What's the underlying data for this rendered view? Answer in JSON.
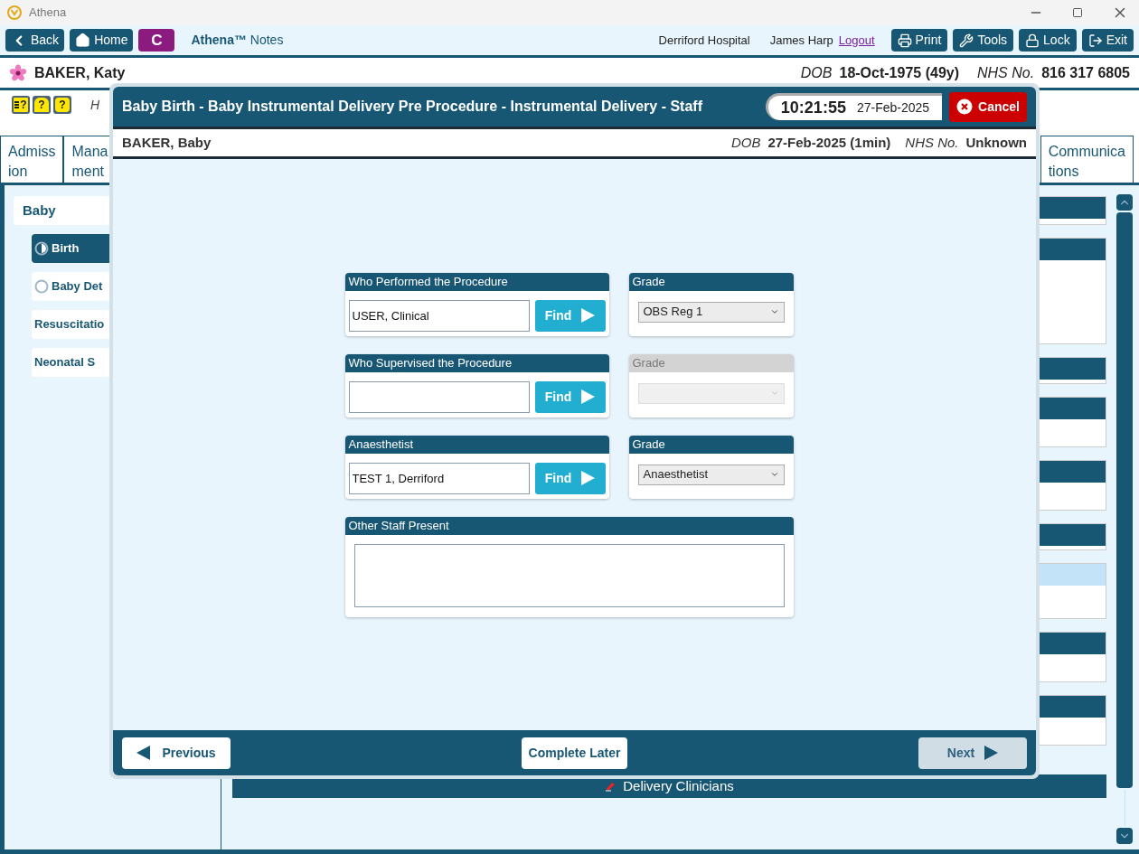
{
  "window": {
    "title": "Athena"
  },
  "toolbar": {
    "buttons": [
      {
        "kind": "back",
        "label": "Back"
      },
      {
        "kind": "home",
        "label": "Home"
      },
      {
        "kind": "letter",
        "label": "C"
      }
    ],
    "app_name": "Athena™",
    "app_suffix": "Notes",
    "hospital": "Derriford Hospital",
    "user": "James Harp",
    "logout": "Logout",
    "actions": [
      {
        "kind": "print",
        "label": "Print"
      },
      {
        "kind": "tools",
        "label": "Tools"
      },
      {
        "kind": "lock",
        "label": "Lock"
      },
      {
        "kind": "exit",
        "label": "Exit"
      }
    ]
  },
  "patient": {
    "name": "BAKER, Katy",
    "dob_label": "DOB",
    "dob": "18-Oct-1975 (49y)",
    "nhs_label": "NHS No.",
    "nhs": "816 317 6805"
  },
  "alert_icons": [
    {
      "kind": "list",
      "glyph": "?"
    },
    {
      "kind": "house",
      "glyph": "?"
    },
    {
      "kind": "note",
      "glyph": "?"
    }
  ],
  "hint": "H",
  "tabs": [
    {
      "lines": [
        "Admiss",
        "ion"
      ],
      "selected": false
    },
    {
      "lines": [
        "Mana",
        "ment"
      ],
      "selected": false
    },
    {
      "lines": [
        "Communica",
        "tions"
      ],
      "selected": false
    }
  ],
  "sidebar": {
    "group": "Baby",
    "items": [
      {
        "label": "Birth",
        "selected": true,
        "kind": "half"
      },
      {
        "label": "Baby Det",
        "selected": false,
        "kind": "empty"
      },
      {
        "label": "Resuscitatio",
        "selected": false,
        "kind": "plain"
      },
      {
        "label": "Neonatal S",
        "selected": false,
        "kind": "plain"
      }
    ]
  },
  "bottom_panel": {
    "title": "Delivery Clinicians"
  },
  "dialog": {
    "title": "Baby Birth - Baby Instrumental Delivery Pre Procedure - Instrumental Delivery - Staff",
    "time": "10:21:55",
    "date": "27-Feb-2025",
    "cancel": "Cancel",
    "baby": {
      "name": "BAKER, Baby",
      "dob_label": "DOB",
      "dob": "27-Feb-2025 (1min)",
      "nhs_label": "NHS No.",
      "nhs": "Unknown"
    },
    "staff_rows": [
      {
        "label": "Who Performed the Procedure",
        "value": "USER, Clinical",
        "find": "Find",
        "grade": {
          "label": "Grade",
          "value": "OBS Reg 1",
          "disabled": false
        }
      },
      {
        "label": "Who Supervised the Procedure",
        "find": "Find",
        "grade": {
          "label": "Grade",
          "disabled": true
        }
      },
      {
        "label": "Anaesthetist",
        "value": "TEST 1, Derriford",
        "find": "Find",
        "grade": {
          "label": "Grade",
          "value": "Anaesthetist",
          "disabled": false
        }
      }
    ],
    "other_staff": {
      "label": "Other Staff Present"
    },
    "footer": {
      "previous": "Previous",
      "complete_later": "Complete Later",
      "next": {
        "label": "Next",
        "disabled": true
      }
    }
  }
}
